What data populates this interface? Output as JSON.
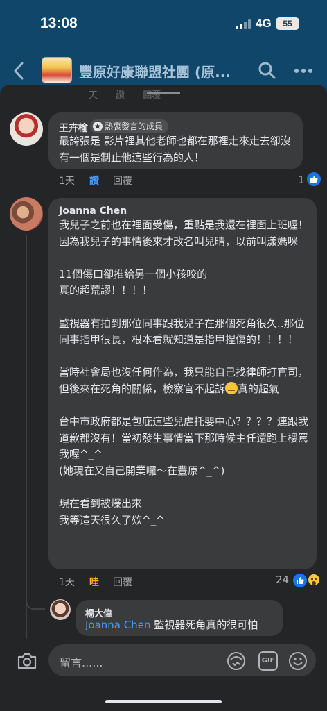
{
  "status_bar": {
    "time": "13:08",
    "network": "4G",
    "battery": "55"
  },
  "header": {
    "title": "豐原好康聯盟社團 (原..."
  },
  "ghost_actions": [
    "天",
    "讚",
    "回覆"
  ],
  "comments": [
    {
      "author": "王卉榆",
      "badge": "熱衷發言的成員",
      "text": "最誇張是 影片裡其他老師也都在那裡走來走去卻沒有一個是制止他這些行為的人！",
      "time": "1天",
      "like_label": "讚",
      "reply_label": "回覆",
      "reaction_count": "1"
    },
    {
      "author": "Joanna Chen",
      "text_a": "我兒子之前也在裡面受傷，重點是我還在裡面上班喔！因為我兒子的事情後來才改名叫兒晴，以前叫漾媽咪\n\n11個傷口卻推給另一個小孩咬的\n真的超荒謬！！！！\n\n監視器有拍到那位同事跟我兒子在那個死角很久..那位同事指甲很長，根本看就知道是指甲捏傷的！！！！\n\n當時社會局也沒任何作為，我只能自己找律師打官司，但後來在死角的關係，檢察官不起訴",
      "text_b": "真的超氣\n\n台中市政府都是包庇這些兒虐托嬰中心？？？？連跟我道歉都沒有！當初發生事情當下那時候主任還跑上樓罵我喔^_^\n(她現在又自己開業囉～在豐原^_^)\n\n現在看到被爆出來\n我等這天很久了欸^_^",
      "time": "1天",
      "like_label": "哇",
      "reply_label": "回覆",
      "reaction_count": "24"
    }
  ],
  "reply": {
    "author": "楊大偉",
    "mention": "Joanna Chen",
    "text": " 監視器死角真的很可怕"
  },
  "composer": {
    "placeholder": "留言......"
  }
}
